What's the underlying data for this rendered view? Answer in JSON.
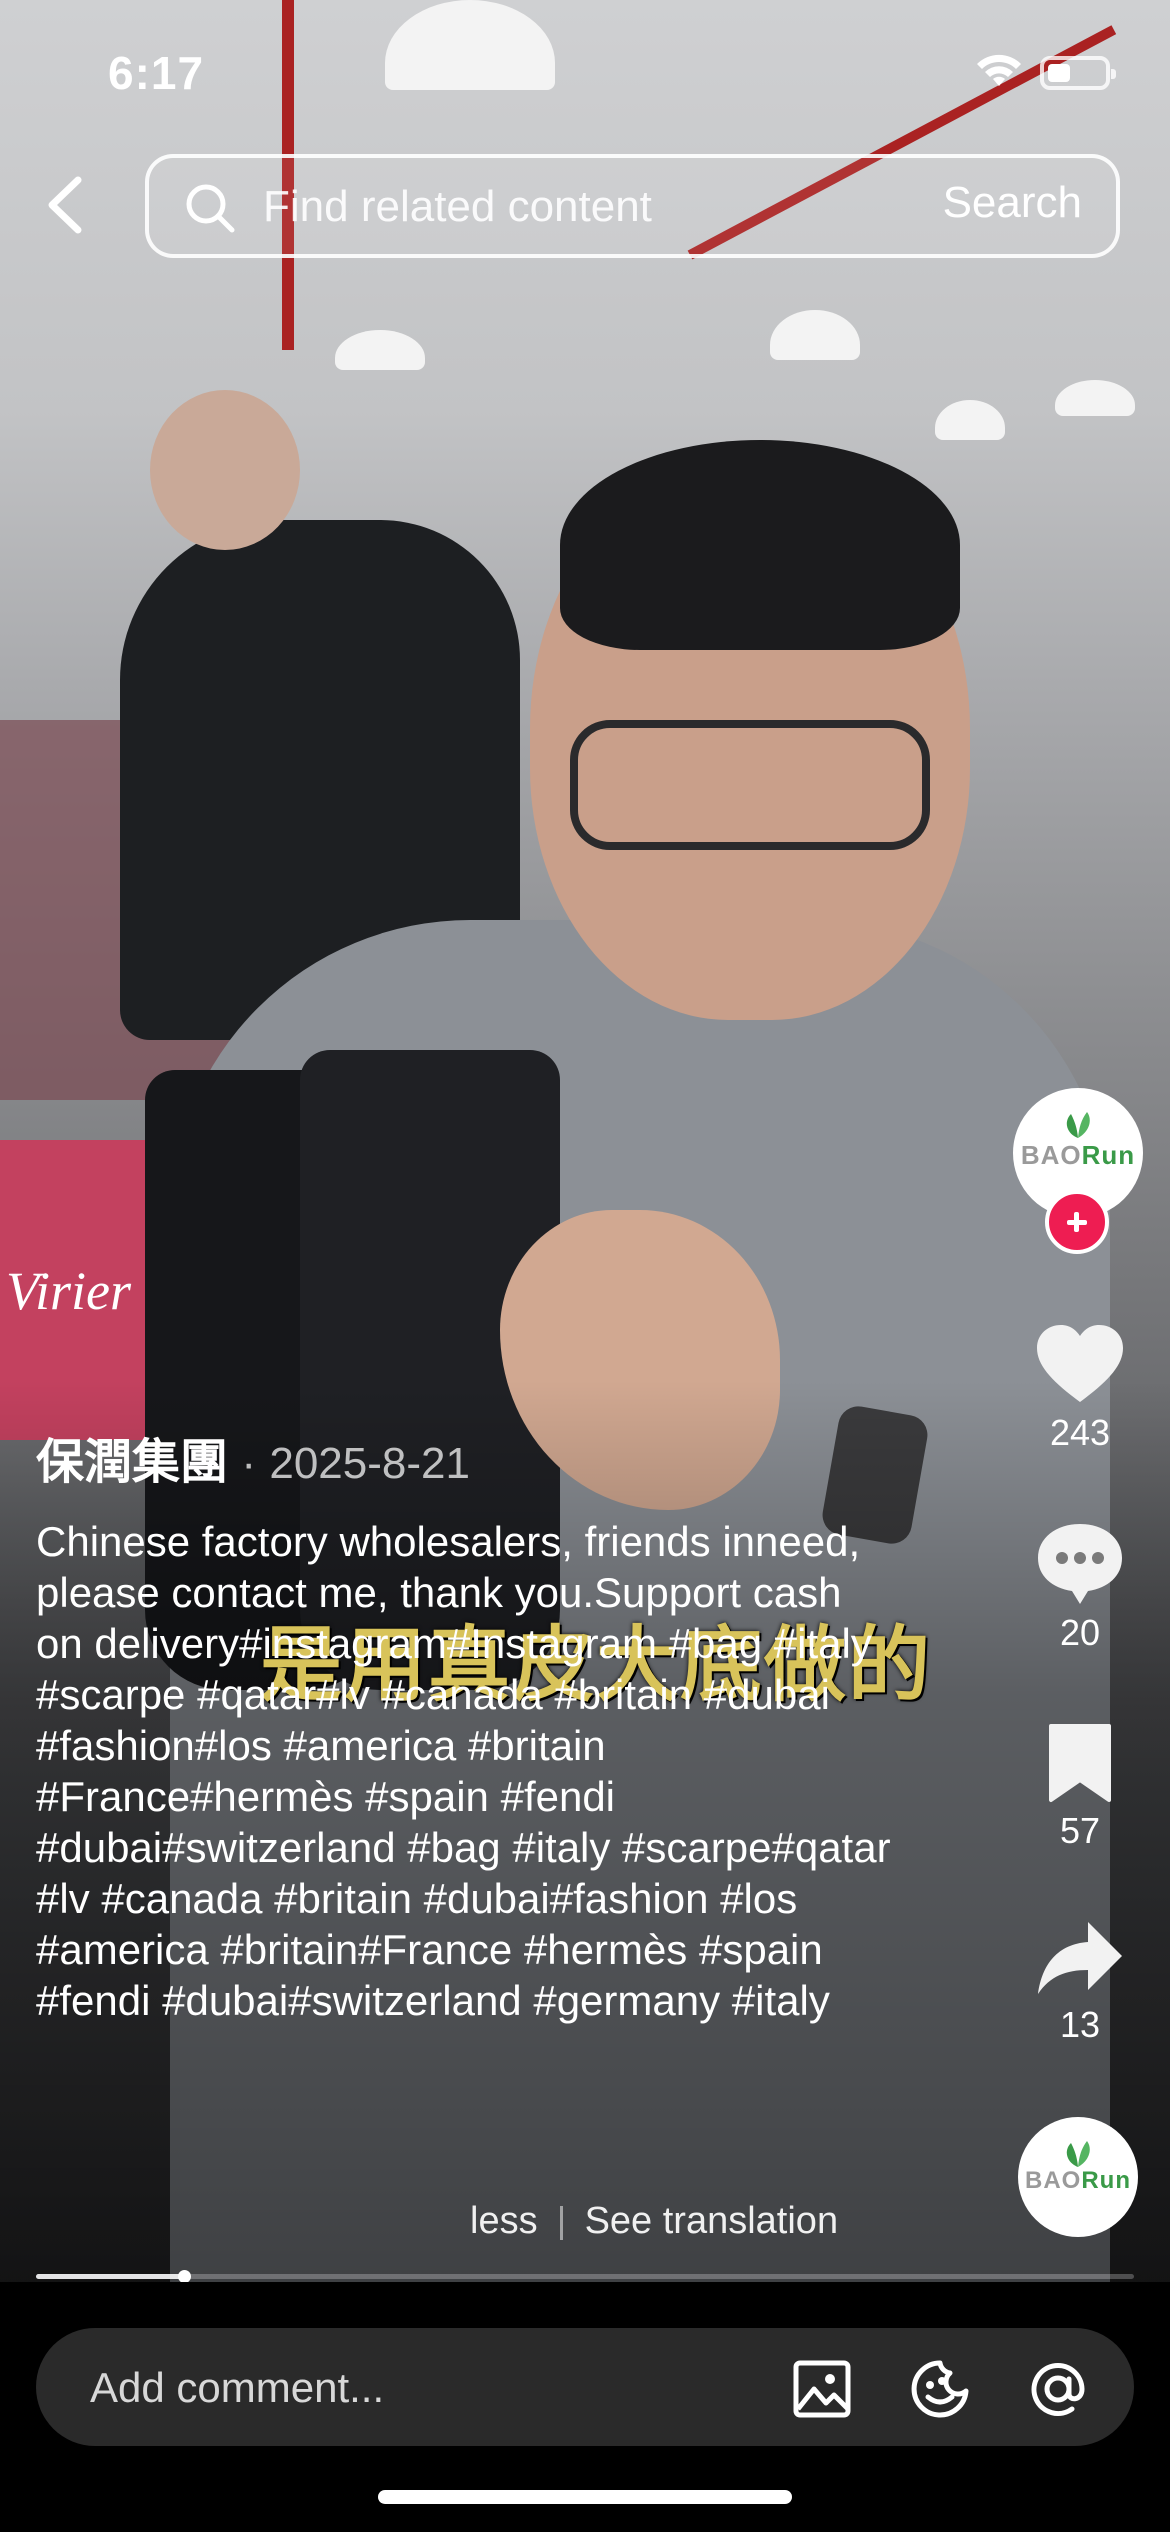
{
  "status_bar": {
    "time": "6:17"
  },
  "search": {
    "placeholder": "Find related content",
    "button_label": "Search"
  },
  "video": {
    "subtitle": "是用真皮大底做的",
    "box_brand": "Virier"
  },
  "author": {
    "name": "保潤集團",
    "separator": "·",
    "date": "2025-8-21",
    "avatar_logo_prefix": "BAO",
    "avatar_logo_suffix": "Run"
  },
  "caption": "Chinese factory wholesalers, friends inneed, please contact me, thank you.Support cash on delivery#instagram#Instagram #bag #italy #scarpe #qatar#lv #canada #britain #dubai #fashion#los #america #britain #France#hermès #spain #fendi #dubai#switzerland #bag #italy #scarpe#qatar #lv #canada #britain #dubai#fashion #los #america #britain#France #hermès #spain #fendi #dubai#switzerland #germany #italy",
  "caption_actions": {
    "less": "less",
    "see_translation": "See translation"
  },
  "rail": {
    "likes": "243",
    "comments": "20",
    "saves": "57",
    "shares": "13"
  },
  "playback": {
    "progress_fraction": 0.135
  },
  "comment_bar": {
    "placeholder": "Add comment..."
  },
  "colors": {
    "follow_red": "#ee1d52",
    "logo_green": "#3a9a48",
    "subtitle_gold": "#d8c35a"
  },
  "icons": [
    "chevron-left-icon",
    "search-icon",
    "wifi-icon",
    "battery-icon",
    "heart-icon",
    "comment-icon",
    "bookmark-icon",
    "share-icon",
    "image-icon",
    "emoji-icon",
    "at-icon",
    "plus-icon"
  ]
}
